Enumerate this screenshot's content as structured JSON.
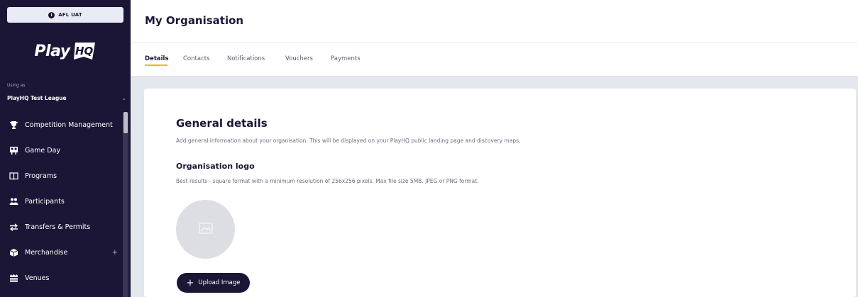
{
  "sidebar": {
    "env_badge": "AFL UAT",
    "logo_text": "Play",
    "logo_hq": "HQ",
    "using_as_label": "Using as",
    "org_name": "PlayHQ Test League",
    "items": [
      {
        "label": "Competition Management",
        "icon": "trophy-icon"
      },
      {
        "label": "Game Day",
        "icon": "scoreboard-icon"
      },
      {
        "label": "Programs",
        "icon": "book-icon"
      },
      {
        "label": "Participants",
        "icon": "people-icon"
      },
      {
        "label": "Transfers & Permits",
        "icon": "transfer-arrows-icon"
      },
      {
        "label": "Merchandise",
        "icon": "box-icon",
        "has_plus": true
      },
      {
        "label": "Venues",
        "icon": "stadium-icon"
      }
    ],
    "plus": "+"
  },
  "header": {
    "title": "My Organisation"
  },
  "tabs": [
    {
      "label": "Details",
      "active": true
    },
    {
      "label": "Contacts",
      "active": false
    },
    {
      "label": "Notifications",
      "active": false
    },
    {
      "label": "Vouchers",
      "active": false
    },
    {
      "label": "Payments",
      "active": false
    }
  ],
  "main": {
    "section_title": "General details",
    "section_description": "Add general information about your organisation. This will be displayed on your PlayHQ public landing page and discovery maps.",
    "logo_title": "Organisation logo",
    "logo_description": "Best results - square format with a minimum resolution of 256x256 pixels. Max file size 5MB. JPEG or PNG format.",
    "upload_button": "Upload Image",
    "upload_icon": "+"
  },
  "colors": {
    "sidebar_bg": "#1c1636",
    "accent": "#f7b500",
    "page_bg": "#e4e7ed"
  }
}
